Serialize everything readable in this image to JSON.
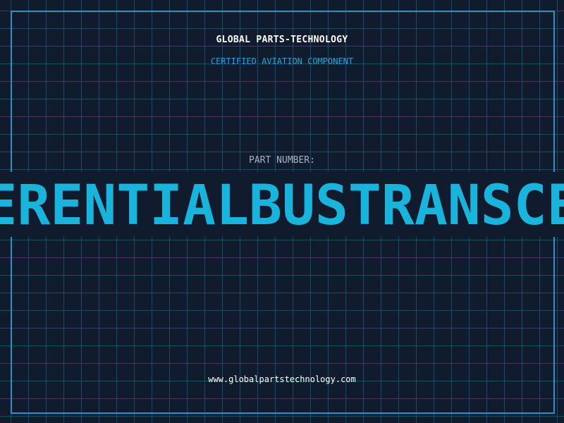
{
  "header": {
    "company": "GLOBAL PARTS-TECHNOLOGY",
    "subtitle": "CERTIFIED AVIATION COMPONENT"
  },
  "part": {
    "label": "PART NUMBER:",
    "value": "DIFFERENTIALBUSTRANSCEIVER"
  },
  "footer": {
    "url": "www.globalpartstechnology.com"
  },
  "colors": {
    "background": "#101b2e",
    "grid": "#1e4a66",
    "frame": "#2596c4",
    "accent": "#18b4dc"
  }
}
